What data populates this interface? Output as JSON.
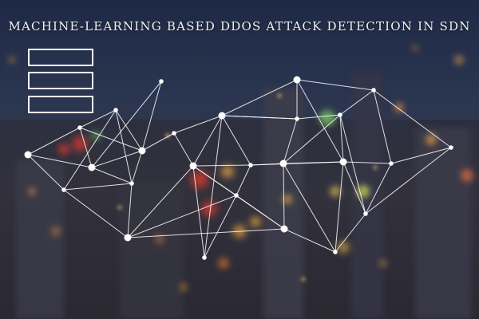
{
  "banner": {
    "title": "MACHINE-LEARNING BASED DDOS ATTACK DETECTION IN SDN"
  },
  "menu_boxes": [
    {
      "name": "menu-box-1"
    },
    {
      "name": "menu-box-2"
    },
    {
      "name": "menu-box-3"
    }
  ],
  "colors": {
    "line": "#ffffff",
    "node": "#ffffff",
    "sky_top": "#1e2a45",
    "ground": "#2a2730"
  }
}
